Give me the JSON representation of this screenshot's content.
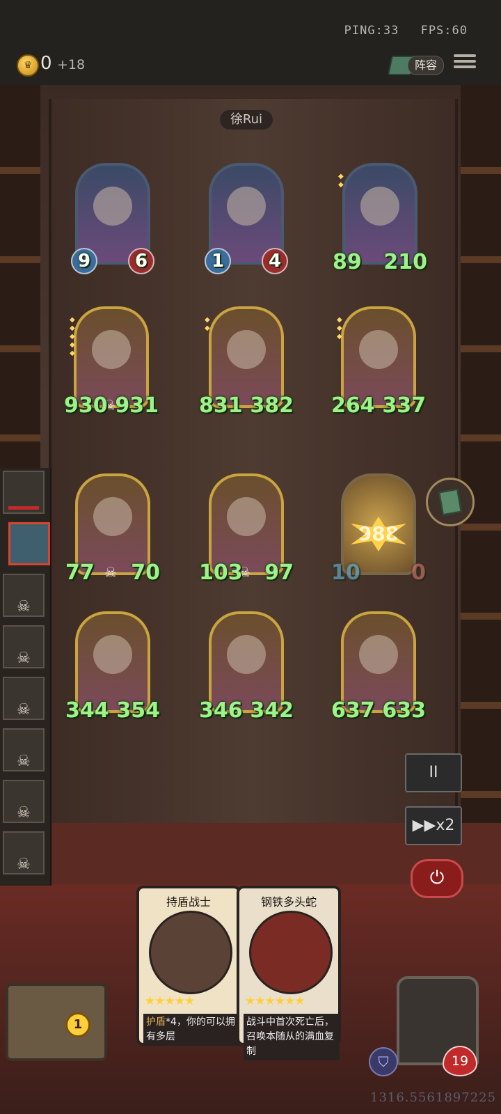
{
  "status": {
    "ping": "PING:33",
    "fps": "FPS:60"
  },
  "header": {
    "gold": "0",
    "gold_income": "+18",
    "lineup_label": "阵容",
    "coin_symbol": "♛"
  },
  "opponent": {
    "name": "徐Rui"
  },
  "units": [
    {
      "attack": "9",
      "health": "6",
      "skull": false
    },
    {
      "attack": "1",
      "health": "4",
      "skull": false
    },
    {
      "attack": "89",
      "health": "210",
      "skull": false
    },
    {
      "attack": "930",
      "health": "931",
      "skull": true
    },
    {
      "attack": "831",
      "health": "382",
      "skull": false
    },
    {
      "attack": "264",
      "health": "337",
      "skull": false
    },
    {
      "attack": "77",
      "health": "70",
      "skull": true
    },
    {
      "attack": "103",
      "health": "97",
      "skull": true
    },
    {
      "attack": "10",
      "health": "0",
      "damage": "988",
      "skull": false
    },
    {
      "attack": "344",
      "health": "354",
      "skull": false
    },
    {
      "attack": "346",
      "health": "342",
      "skull": false
    },
    {
      "attack": "637",
      "health": "633",
      "skull": false
    }
  ],
  "controls": {
    "pause": "II",
    "speed": "▶▶x2",
    "power": "⏻"
  },
  "cards": [
    {
      "name": "持盾战士",
      "stars": "★★★★★",
      "desc_highlight": "护盾",
      "desc": "*4，你的可以拥有多层"
    },
    {
      "name": "钢铁多头蛇",
      "stars": "★★★★★★",
      "desc_highlight": "",
      "desc": "战斗中首次死亡后，召唤本随从的满血复制"
    }
  ],
  "chest": {
    "level": "1"
  },
  "player": {
    "health": "19",
    "shield_icon": "shield-icon"
  },
  "user_id": "1316.5561897225",
  "colors": {
    "stat_green": "#9ef28a",
    "frame_gold": "#c9a441",
    "accent_red": "#c02a2a"
  }
}
